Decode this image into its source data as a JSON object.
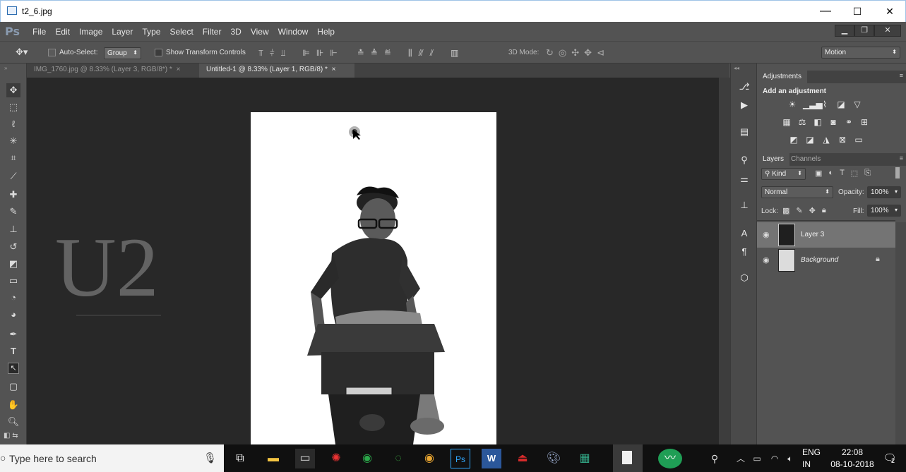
{
  "window": {
    "title": "t2_6.jpg",
    "min": "—",
    "max": "☐",
    "close": "✕"
  },
  "menubar": {
    "logo": "Ps",
    "items": [
      "File",
      "Edit",
      "Image",
      "Layer",
      "Type",
      "Select",
      "Filter",
      "3D",
      "View",
      "Window",
      "Help"
    ],
    "win_min": "▁",
    "win_restore": "❐",
    "win_close": "✕"
  },
  "options": {
    "auto_select_label": "Auto-Select:",
    "auto_select_value": "Group",
    "show_transform_label": "Show Transform Controls",
    "mode_label": "3D Mode:",
    "workspace": "Motion"
  },
  "tabs": [
    {
      "label": "IMG_1760.jpg @ 8.33% (Layer 3, RGB/8*) *",
      "close": "×"
    },
    {
      "label": "Untitled-1 @ 8.33% (Layer 1, RGB/8) *",
      "close": "×"
    }
  ],
  "canvas": {
    "watermark": "U2"
  },
  "adjustments": {
    "tab": "Adjustments",
    "heading": "Add an adjustment"
  },
  "layers_panel": {
    "tab_layers": "Layers",
    "tab_channels": "Channels",
    "kind_label": "Kind",
    "blend_mode": "Normal",
    "opacity_label": "Opacity:",
    "opacity_value": "100%",
    "lock_label": "Lock:",
    "fill_label": "Fill:",
    "fill_value": "100%",
    "layers": [
      {
        "name": "Layer 3",
        "selected": true
      },
      {
        "name": "Background",
        "selected": false
      }
    ]
  },
  "taskbar": {
    "search_placeholder": "Type here to search",
    "lang_top": "ENG",
    "lang_bottom": "IN",
    "time": "22:08",
    "date": "08-10-2018",
    "notif_count": "2"
  },
  "colors": {
    "ps_dark": "#535353",
    "canvas_bg": "#282828",
    "selected_layer": "#747474",
    "ps_blue": "#31a8ff"
  }
}
